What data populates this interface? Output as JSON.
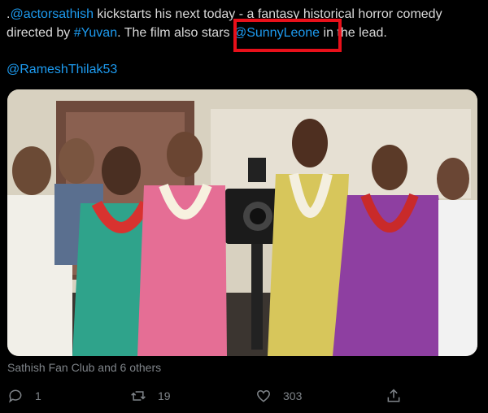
{
  "tweet": {
    "line1_prefix": ".",
    "mention_actor": "@actorsathish",
    "line1_mid": " kickstarts his next today - a fantasy historical horror comedy directed by ",
    "hashtag_director": "#Yuvan",
    "line2_mid": ". The film also stars ",
    "mention_lead": "@SunnyLeone",
    "line2_end": " in the lead.",
    "mention_second": "@RameshThilak53"
  },
  "highlight": {
    "color": "#e8101a"
  },
  "photo": {
    "icon": "group-photo-image"
  },
  "social_context": "Sathish Fan Club and 6 others",
  "actions": {
    "reply": {
      "icon": "reply-icon",
      "count": "1"
    },
    "retweet": {
      "icon": "retweet-icon",
      "count": "19"
    },
    "like": {
      "icon": "heart-icon",
      "count": "303"
    },
    "share": {
      "icon": "share-icon"
    }
  },
  "colors": {
    "link": "#1d9bf0",
    "text": "#d9d9d9",
    "muted": "#7f8489",
    "background": "#000000"
  }
}
